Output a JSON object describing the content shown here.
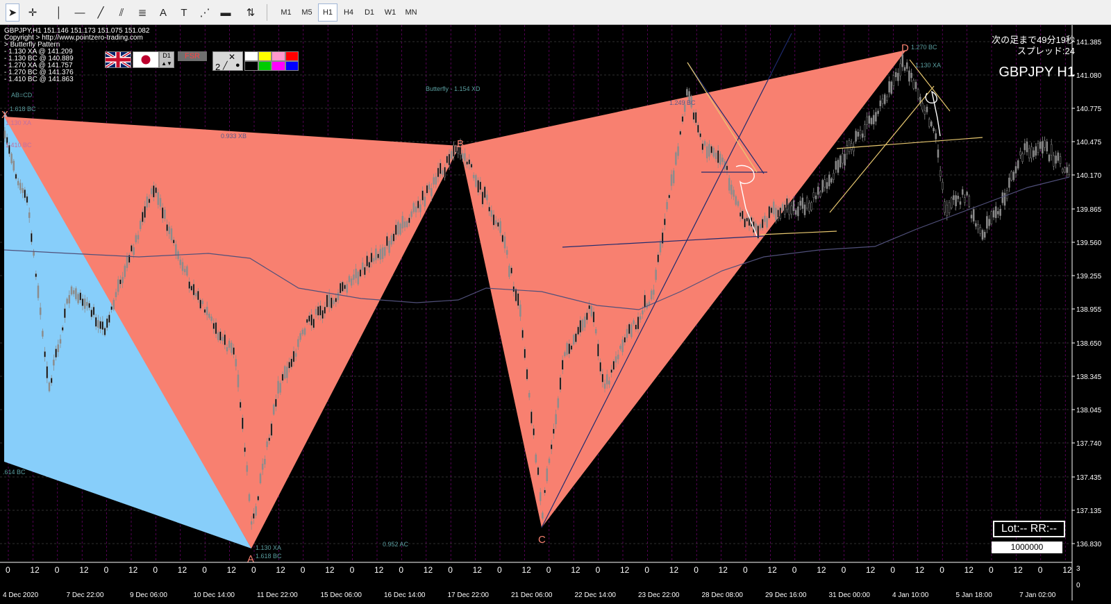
{
  "toolbar": {
    "tools": [
      {
        "name": "cursor",
        "glyph": "➤"
      },
      {
        "name": "crosshair",
        "glyph": "✛"
      },
      {
        "name": "vertical-line",
        "glyph": "│"
      },
      {
        "name": "horizontal-line",
        "glyph": "—"
      },
      {
        "name": "trendline",
        "glyph": "╱"
      },
      {
        "name": "channel",
        "glyph": "⫽"
      },
      {
        "name": "fibonacci",
        "glyph": "≣"
      },
      {
        "name": "text",
        "glyph": "A"
      },
      {
        "name": "text-label",
        "glyph": "T"
      },
      {
        "name": "fibonacci-fan",
        "glyph": "⋰"
      },
      {
        "name": "rectangle",
        "glyph": "▬"
      },
      {
        "name": "arrows",
        "glyph": "⇅"
      }
    ],
    "timeframes": [
      "M1",
      "M5",
      "H1",
      "H4",
      "D1",
      "W1",
      "MN"
    ],
    "active_timeframe": "H1"
  },
  "chart_header": {
    "symbol_line": "GBPJPY,H1  151.146 151.173 151.075 151.082",
    "copyright": "Copyright > http://www.pointzero-trading.com",
    "pattern_name": "> Butterfly Pattern",
    "levels": [
      "- 1.130 XA @ 141.209",
      "- 1.130 BC @ 140.889",
      "- 1.270 XA @ 141.757",
      "- 1.270 BC @ 141.376",
      "- 1.410 BC @ 141.863"
    ]
  },
  "panel": {
    "flags": [
      "uk-flag",
      "japan-flag"
    ],
    "timeframe_button": "D1",
    "fsr_button": "FSR",
    "line_width": "2",
    "palette": [
      "#ffffff",
      "#ffff00",
      "#ff99cc",
      "#ff0000",
      "#000000",
      "#00cc00",
      "#ff00ff",
      "#0000ff"
    ]
  },
  "clock": {
    "next_bar": "次の足まで49分19秒",
    "spread": "スプレッド:24"
  },
  "symbol_title": "GBPJPY H1",
  "lot_panel": {
    "label": "Lot:-- RR:--",
    "input_value": "1000000"
  },
  "pattern": {
    "points": {
      "X": "X",
      "A": "A",
      "B": "B",
      "C": "C",
      "D": "D"
    },
    "annotations": {
      "ab_cd": "AB=CD",
      "xa_1618": "1.618 BC",
      "xb": "0.933 XB",
      "xd": "Butterfly - 1.154 XD",
      "bc_1249": "1.249 BC",
      "d_1270": "1.270 BC",
      "d_1130": "1.130 XA",
      "a_1130": "1.130 XA",
      "a_1618": "1.618 BC",
      "ac": "0.952 AC",
      "left_614": ".614 BC",
      "left_1410": "1.410 BC",
      "left_x": "1.130 XA"
    }
  },
  "price_axis": [
    "141.385",
    "141.080",
    "140.775",
    "140.475",
    "140.170",
    "139.865",
    "139.560",
    "139.255",
    "138.955",
    "138.650",
    "138.345",
    "138.045",
    "137.740",
    "137.435",
    "137.135",
    "136.830"
  ],
  "time_axis": {
    "hour_labels": [
      "0",
      "12",
      "0",
      "12",
      "0",
      "12",
      "0",
      "12",
      "0",
      "12",
      "0",
      "12",
      "0",
      "12",
      "0",
      "12",
      "0",
      "12",
      "0",
      "12",
      "0",
      "12",
      "0",
      "12",
      "0",
      "12",
      "0",
      "12",
      "0",
      "12",
      "0",
      "12",
      "0",
      "12",
      "0",
      "12",
      "0",
      "12",
      "0",
      "12",
      "0",
      "12",
      "0",
      "12"
    ],
    "date_labels": [
      "4 Dec 2020",
      "7 Dec 22:00",
      "9 Dec 06:00",
      "10 Dec 14:00",
      "11 Dec 22:00",
      "15 Dec 06:00",
      "16 Dec 14:00",
      "17 Dec 22:00",
      "21 Dec 06:00",
      "22 Dec 14:00",
      "23 Dec 22:00",
      "28 Dec 08:00",
      "29 Dec 16:00",
      "31 Dec 00:00",
      "4 Jan 10:00",
      "5 Jan 18:00",
      "7 Jan 02:00"
    ],
    "scale_top": "3",
    "scale_bottom": "0"
  },
  "colors": {
    "pattern_fill": "#f88070",
    "left_fill": "#87cefa",
    "grid": "#8b008b",
    "candles": "#8c8c8c",
    "moving_average": "#50507a",
    "trendlines": "#e8c870",
    "navy_lines": "#1e2a6e"
  }
}
